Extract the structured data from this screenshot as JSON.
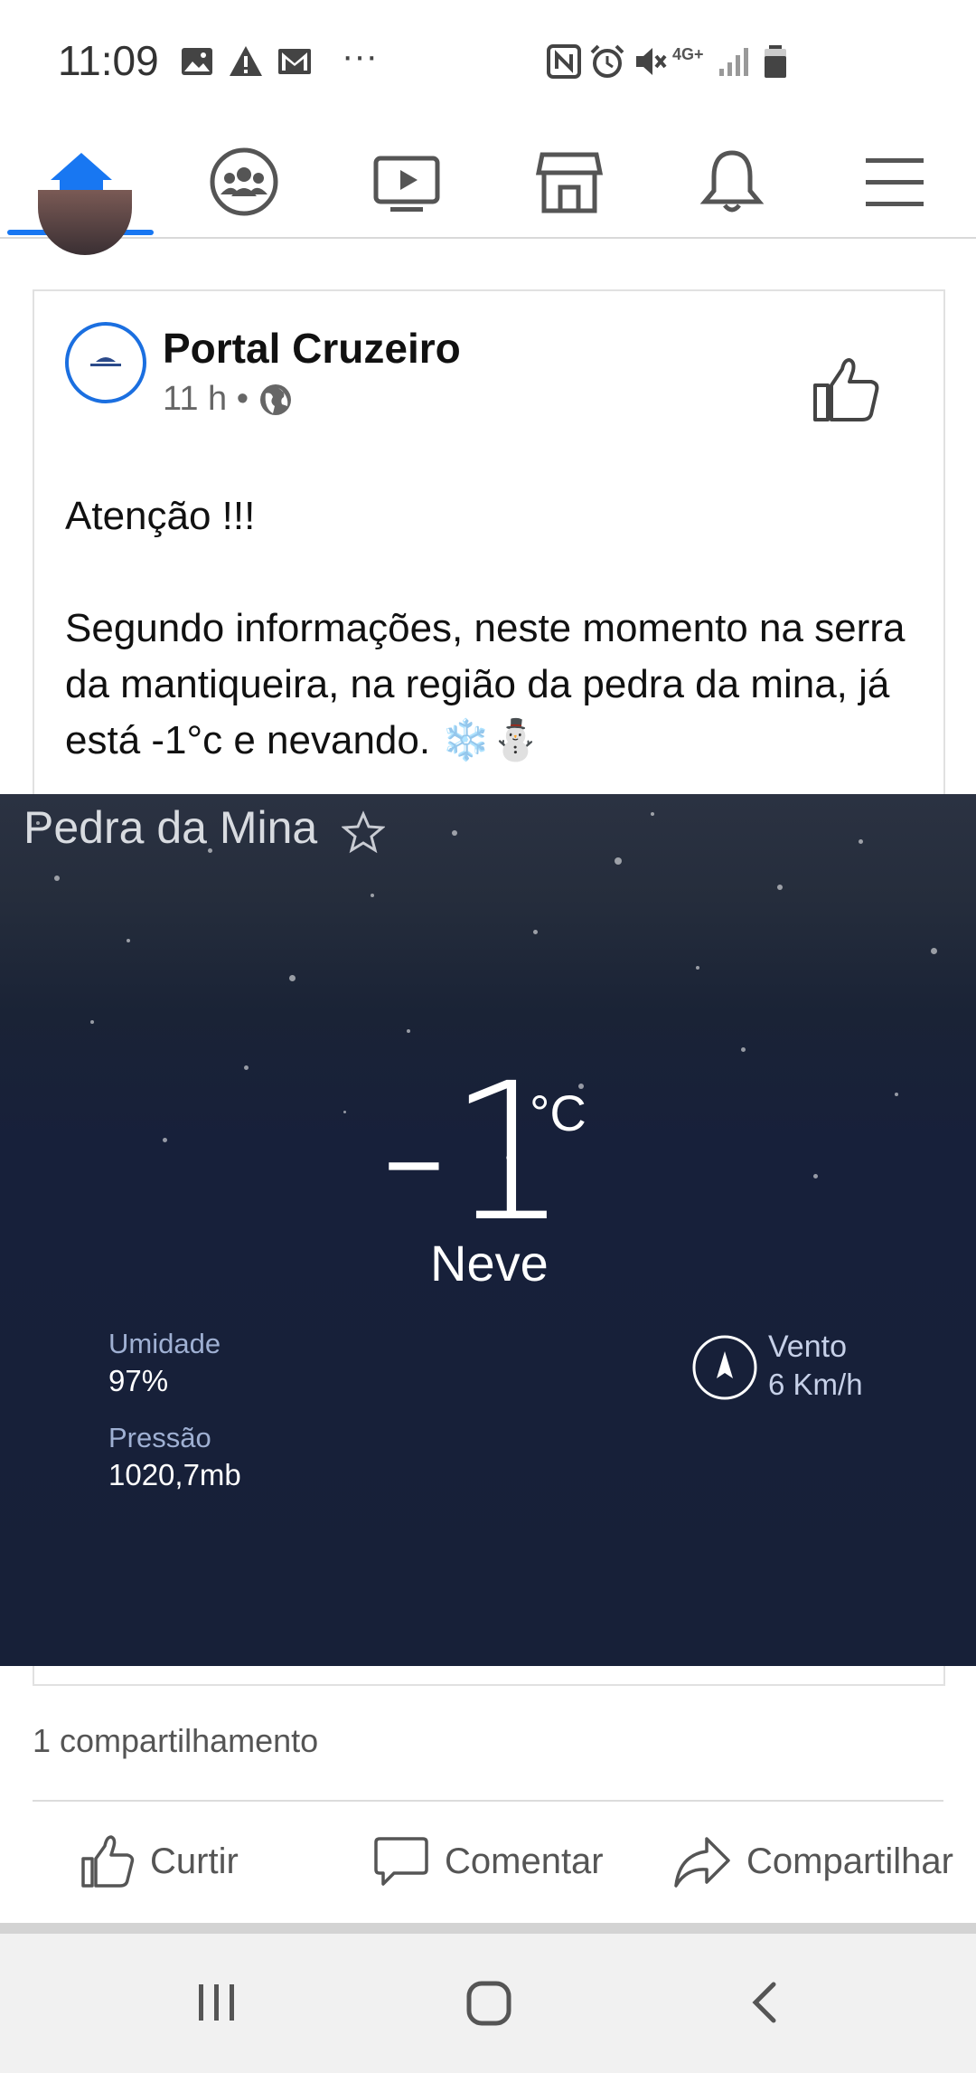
{
  "status_bar": {
    "time": "11:09",
    "icons": [
      "image-icon",
      "alert-icon",
      "gmail-icon",
      "more-dots-icon",
      "nfc-icon",
      "alarm-icon",
      "mute-icon",
      "4g-icon",
      "signal-icon",
      "battery-icon"
    ],
    "more": "···",
    "network": "4G+"
  },
  "nav": {
    "tabs": [
      "home",
      "groups",
      "watch",
      "marketplace",
      "notifications",
      "menu"
    ],
    "active": "home",
    "accent": "#1877f2"
  },
  "post": {
    "page_name": "Portal Cruzeiro",
    "time": "11 h •",
    "text_line1": "Atenção !!!",
    "text_body": "Segundo informações, neste momento na serra da mantiqueira, na região da pedra da mina, já está -1°c e nevando. ❄️⛄"
  },
  "weather": {
    "location": "Pedra da Mina",
    "temperature": "-1",
    "unit": "°C",
    "condition": "Neve",
    "humidity_label": "Umidade",
    "humidity_value": "97%",
    "pressure_label": "Pressão",
    "pressure_value": "1020,7mb",
    "wind_label": "Vento",
    "wind_value": "6 Km/h"
  },
  "footer": {
    "shares": "1 compartilhamento",
    "like": "Curtir",
    "comment": "Comentar",
    "share": "Compartilhar"
  }
}
